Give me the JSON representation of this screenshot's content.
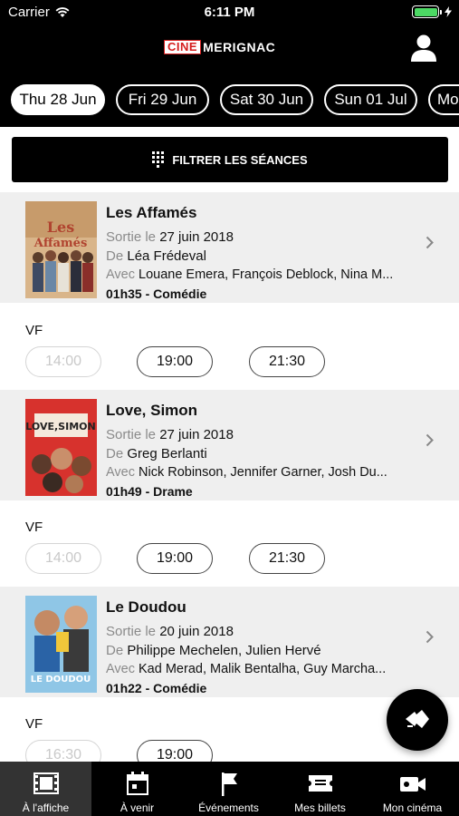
{
  "status": {
    "carrier": "Carrier",
    "time": "6:11 PM"
  },
  "header": {
    "logo_part1": "CINE",
    "logo_part2": "MERIGNAC"
  },
  "dates": [
    "Thu 28 Jun",
    "Fri 29 Jun",
    "Sat 30 Jun",
    "Sun 01 Jul",
    "Mon"
  ],
  "filter": {
    "label": "FILTRER LES SÉANCES"
  },
  "movies": [
    {
      "title": "Les Affamés",
      "release_prefix": "Sortie le",
      "release": "27 juin 2018",
      "director_prefix": "De",
      "director": "Léa Frédeval",
      "cast_prefix": "Avec",
      "cast": "Louane Emera,  François Deblock,  Nina M...",
      "info": "01h35 - Comédie",
      "version": "VF",
      "times": [
        "14:00",
        "19:00",
        "21:30"
      ],
      "poster_colors": [
        "#c79b6b",
        "#b0432f",
        "#6a87a6"
      ]
    },
    {
      "title": "Love, Simon",
      "release_prefix": "Sortie le",
      "release": "27 juin 2018",
      "director_prefix": "De",
      "director": "Greg Berlanti",
      "cast_prefix": "Avec",
      "cast": "Nick Robinson,  Jennifer Garner,  Josh Du...",
      "info": "01h49 - Drame",
      "version": "VF",
      "times": [
        "14:00",
        "19:00",
        "21:30"
      ],
      "poster_colors": [
        "#d7322d",
        "#f4e9dc",
        "#5b3a2b"
      ]
    },
    {
      "title": "Le Doudou",
      "release_prefix": "Sortie le",
      "release": "20 juin 2018",
      "director_prefix": "De",
      "director": "Philippe Mechelen,  Julien Hervé",
      "cast_prefix": "Avec",
      "cast": "Kad Merad,  Malik Bentalha,  Guy Marcha...",
      "info": "01h22 - Comédie",
      "version": "VF",
      "times": [
        "16:30",
        "19:00"
      ],
      "poster_colors": [
        "#8fc6e6",
        "#2a63a6",
        "#f1c73a"
      ]
    }
  ],
  "tabs": [
    "À l'affiche",
    "À venir",
    "Événements",
    "Mes billets",
    "Mon cinéma"
  ]
}
